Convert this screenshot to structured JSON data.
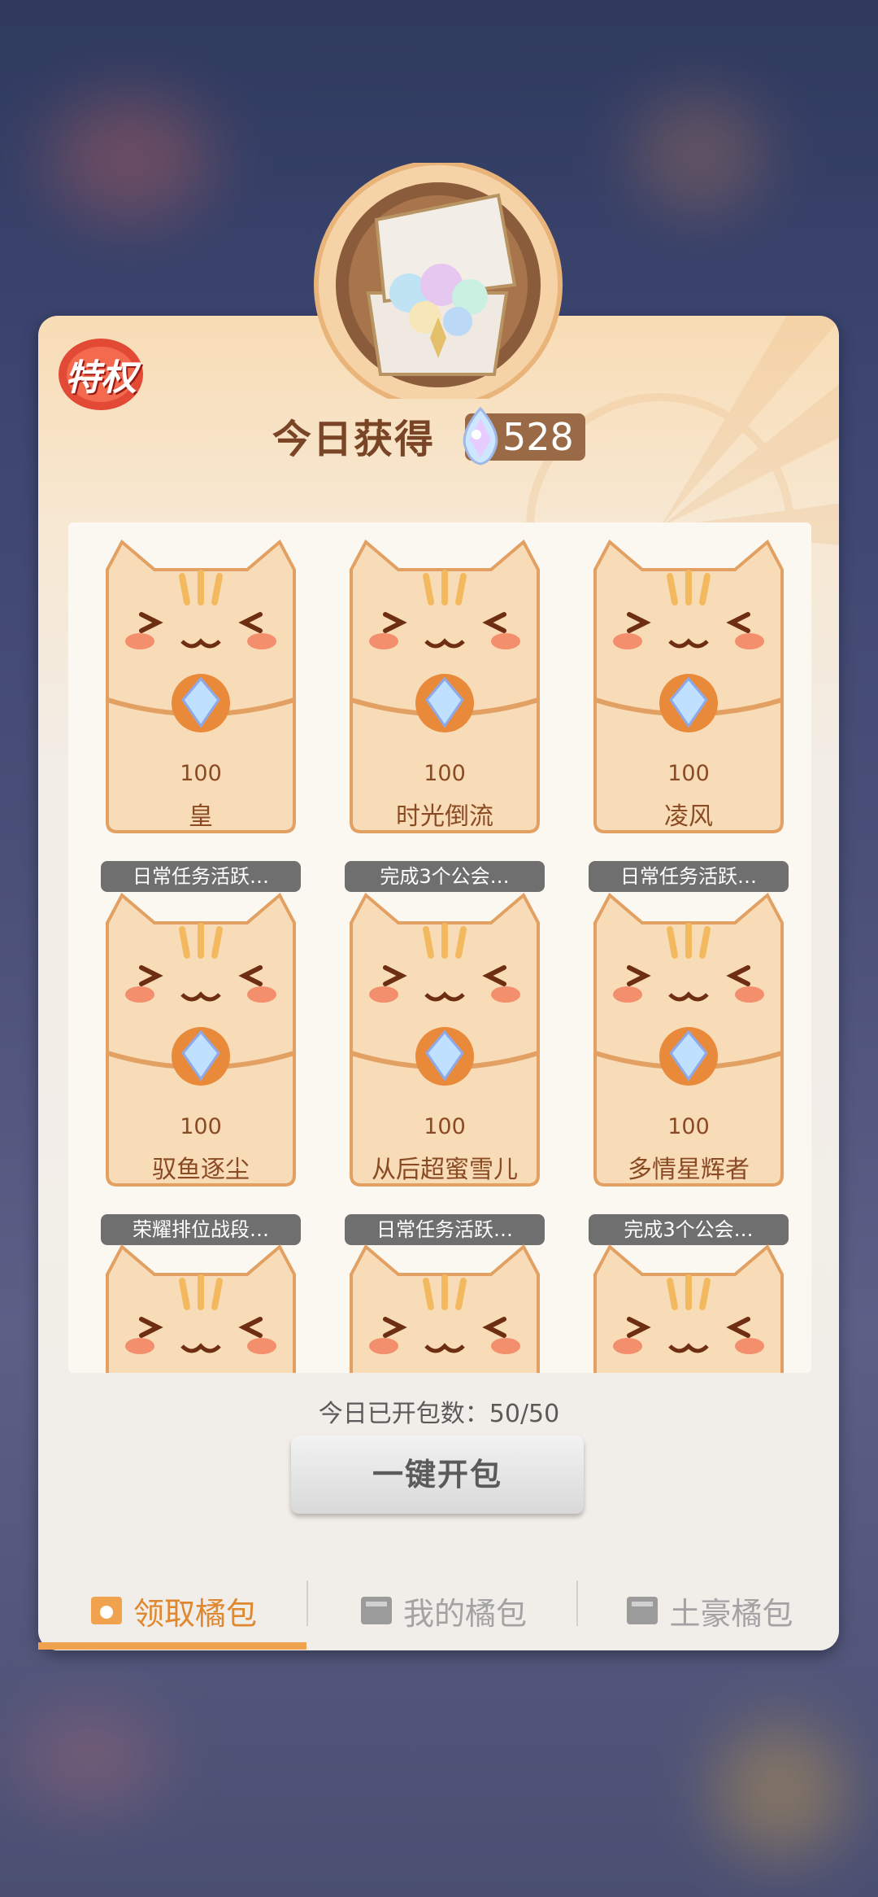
{
  "badge": {
    "label": "特权"
  },
  "header": {
    "title": "今日获得",
    "total": "528"
  },
  "cards": [
    {
      "value": "100",
      "name": "皇",
      "task": "日常任务活跃…"
    },
    {
      "value": "100",
      "name": "时光倒流",
      "task": "完成3个公会…"
    },
    {
      "value": "100",
      "name": "凌风",
      "task": "日常任务活跃…"
    },
    {
      "value": "100",
      "name": "驭鱼逐尘",
      "task": "荣耀排位战段…"
    },
    {
      "value": "100",
      "name": "从后超蜜雪儿",
      "task": "日常任务活跃…"
    },
    {
      "value": "100",
      "name": "多情星辉者",
      "task": "完成3个公会…"
    }
  ],
  "footer": {
    "open_count": "今日已开包数：50/50",
    "open_all_label": "一键开包"
  },
  "tabs": [
    {
      "label": "领取橘包",
      "active": true
    },
    {
      "label": "我的橘包",
      "active": false
    },
    {
      "label": "土豪橘包",
      "active": false
    }
  ],
  "colors": {
    "accent": "#f0a24e",
    "title": "#7a4426",
    "card": "#f8dcb8"
  }
}
